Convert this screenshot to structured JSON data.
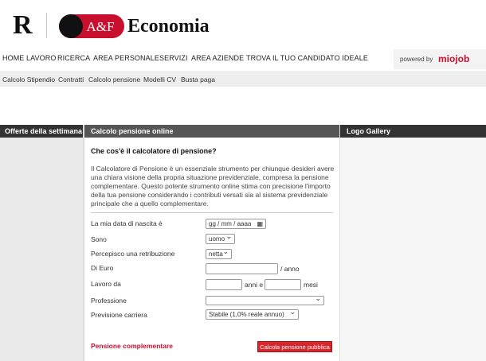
{
  "header": {
    "brand_letter": "R",
    "brand_af": "A&F",
    "brand_name": "Economia"
  },
  "nav": {
    "items": [
      "HOME LAVORO",
      "RICERCA",
      "AREA PERSONALE",
      "SERVIZI",
      "AREA AZIENDE",
      "TROVA IL TUO CANDIDATO IDEALE"
    ],
    "powered_label": "powered by",
    "powered_brand": "miojob"
  },
  "subnav": {
    "items": [
      "Calcolo Stipendio",
      "Contratti",
      "Calcolo pensione",
      "Modelli CV",
      "Busta paga"
    ]
  },
  "left": {
    "heading": "Offerte della settimana"
  },
  "right": {
    "heading": "Logo Gallery"
  },
  "main": {
    "heading": "Calcolo pensione online",
    "question": "Che cos'è il calcolatore di pensione?",
    "intro": "Il Calcolatore di Pensione è un essenziale strumento per chiunque desideri avere una chiara visione della propria situazione previdenziale, compresa la pensione complementare. Questo potente strumento online stima con precisione l'importo della tua pensione considerando i contributi versati sia al sistema previdenziale principale che a quello complementare.",
    "form": {
      "birth_label": "La mia data di nascita è",
      "birth_placeholder": "gg / mm / aaaa",
      "sex_label": "Sono",
      "sex_value": "uomo",
      "income_label": "Percepisco una retribuzione",
      "income_value": "netta",
      "euro_label": "Di Euro",
      "euro_value": "",
      "euro_suffix": "/ anno",
      "work_label": "Lavoro da",
      "years_value": "",
      "years_suffix": "anni e",
      "months_value": "",
      "months_suffix": "mesi",
      "profession_label": "Professione",
      "profession_value": "",
      "career_label": "Previsione carriera",
      "career_value": "Stabile (1,0% reale annuo)"
    },
    "pension_link": "Pensione complementare",
    "calc_button": "Calcola pensione pubblica"
  },
  "colors": {
    "accent": "#c8102e",
    "dark_header": "#333333"
  }
}
